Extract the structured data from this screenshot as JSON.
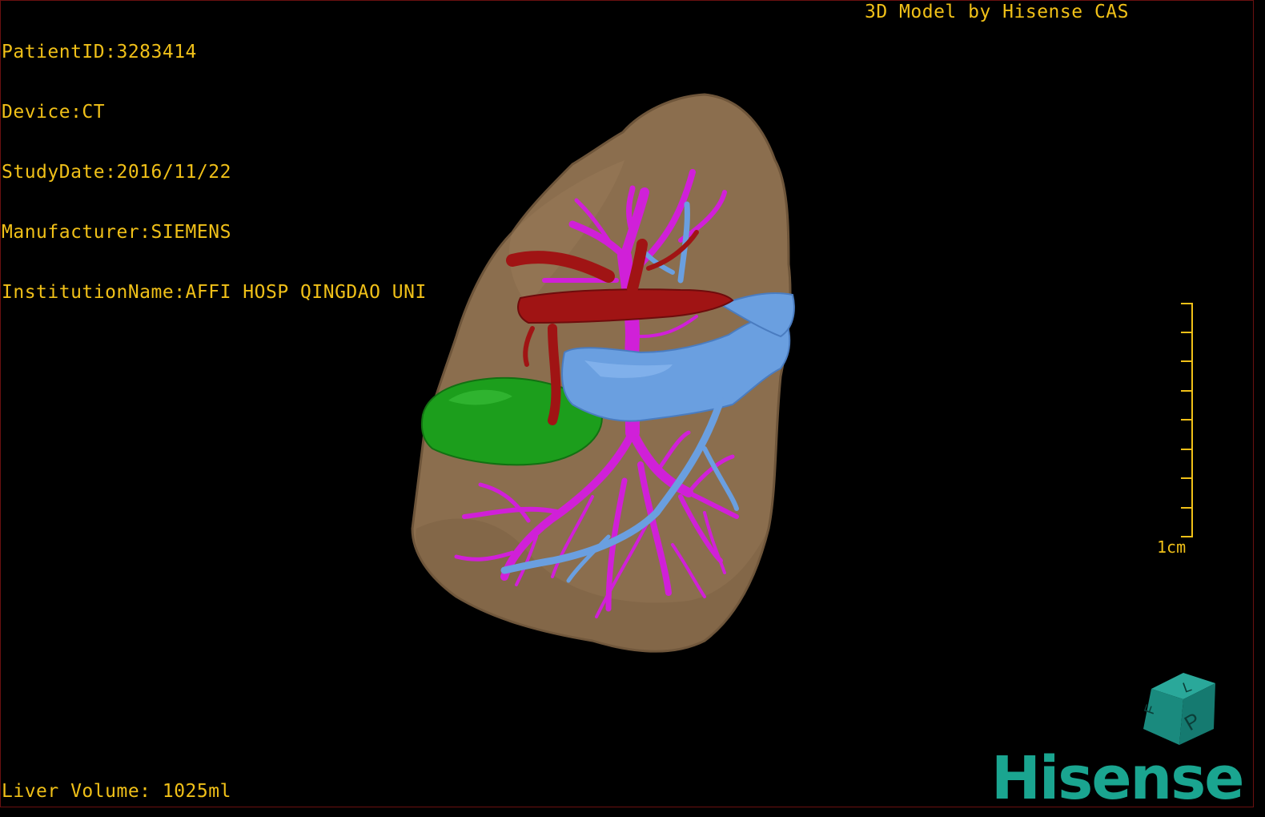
{
  "overlay": {
    "patient_id": "PatientID:3283414",
    "device": "Device:CT",
    "study_date": "StudyDate:2016/11/22",
    "manufacturer": "Manufacturer:SIEMENS",
    "institution": "InstitutionName:AFFI HOSP QINGDAO UNI",
    "credit": "3D Model by Hisense CAS",
    "liver_volume": "Liver Volume: 1025ml"
  },
  "scale": {
    "label": "1cm"
  },
  "orientation_cube": {
    "faces": [
      "F",
      "L",
      "P"
    ],
    "color": "#1a8a7e"
  },
  "logo": {
    "text": "Hisense",
    "color": "#1aa590"
  },
  "colors": {
    "overlay_text": "#f0c018",
    "liver": "#8b6e4e",
    "portal_vein": "#d020d8",
    "hepatic_vein": "#6a9fe0",
    "artery": "#a01414",
    "gallbladder": "#1c9e1c"
  }
}
